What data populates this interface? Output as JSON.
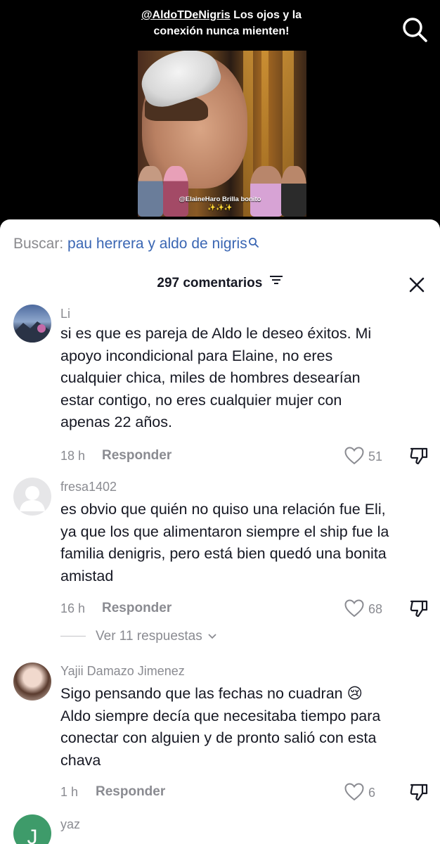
{
  "video": {
    "caption_handle": "@AldoTDeNigris",
    "caption_text_1": " Los ojos  y la",
    "caption_text_2": "conexión nunca mienten!",
    "thumb_overlay_1": "@ElaineHaro Brilla bonito",
    "thumb_overlay_2": "✨✨✨"
  },
  "search": {
    "label": "Buscar:",
    "query": "pau herrera y aldo de nigris"
  },
  "comments_header": {
    "count_label": "297 comentarios"
  },
  "reply_label": "Responder",
  "comments": [
    {
      "username": "Li",
      "lines": [
        "si es que es pareja de Aldo le deseo éxitos. Mi",
        "apoyo incondicional para Elaine, no eres",
        "cualquier chica, miles de hombres desearían",
        "estar contigo, no eres cualquier mujer con",
        "apenas 22 años."
      ],
      "time": "18 h",
      "likes": "51"
    },
    {
      "username": "fresa1402",
      "lines": [
        "es obvio que quién no quiso una relación fue Eli,",
        "ya que los que alimentaron siempre el ship fue la",
        "familia denigris, pero está bien quedó una bonita",
        "amistad"
      ],
      "time": "16 h",
      "likes": "68",
      "view_replies": "Ver 11 respuestas"
    },
    {
      "username": "Yajii Damazo Jimenez",
      "lines": [
        "Sigo pensando que las fechas no cuadran 😢",
        "Aldo siempre decía que necesitaba tiempo para",
        "conectar con alguien y de pronto salió con esta",
        "chava"
      ],
      "time": "1 h",
      "likes": "6"
    },
    {
      "username": "yaz"
    }
  ],
  "icons": {
    "search": "search-icon",
    "filter": "filter-icon",
    "close": "close-icon",
    "like": "heart-icon",
    "dislike": "thumbs-down-icon",
    "chevron": "chevron-down-icon"
  },
  "colors": {
    "query_link": "#3a66b3",
    "text": "#161823",
    "muted": "#8a8b91",
    "yaz_avatar": "#3e9b6a"
  }
}
